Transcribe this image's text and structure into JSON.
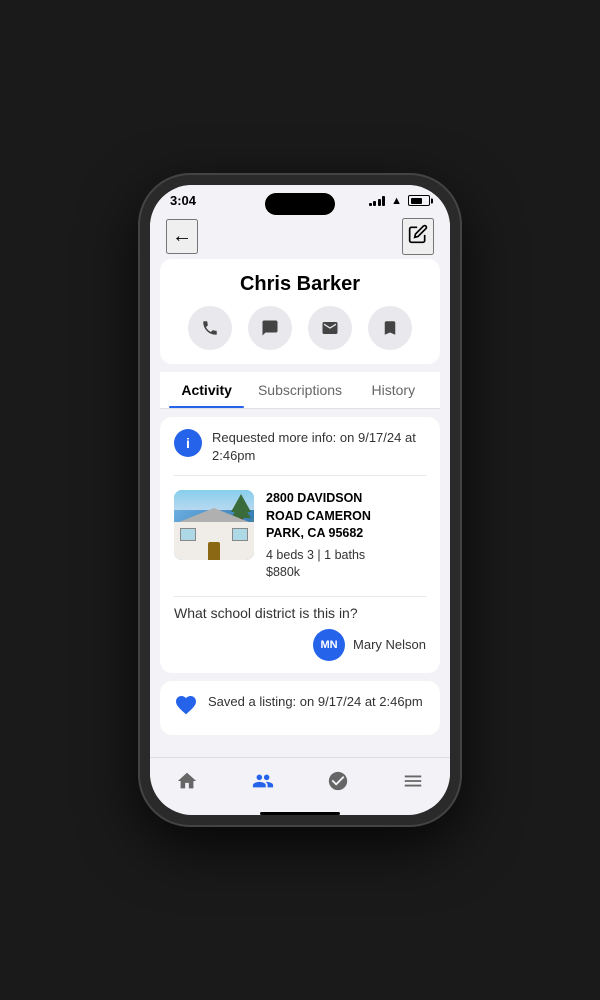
{
  "status_bar": {
    "time": "3:04",
    "signal": true,
    "wifi": true,
    "battery": true
  },
  "nav": {
    "back_label": "←",
    "edit_label": "✎"
  },
  "contact": {
    "name": "Chris Barker"
  },
  "action_buttons": [
    {
      "id": "phone",
      "icon": "📞",
      "label": "Phone"
    },
    {
      "id": "message",
      "icon": "💬",
      "label": "Message"
    },
    {
      "id": "email",
      "icon": "✉",
      "label": "Email"
    },
    {
      "id": "bookmark",
      "icon": "🔖",
      "label": "Bookmark"
    }
  ],
  "tabs": [
    {
      "id": "activity",
      "label": "Activity",
      "active": true
    },
    {
      "id": "subscriptions",
      "label": "Subscriptions",
      "active": false
    },
    {
      "id": "history",
      "label": "History",
      "active": false
    }
  ],
  "activity": {
    "info_icon": "i",
    "request_text": "Requested more info: on 9/17/24 at 2:46pm",
    "property": {
      "address_line1": "2800 DAVIDSON",
      "address_line2": "ROAD CAMERON",
      "address_line3": "PARK, CA 95682",
      "beds": "4 beds 3 | 1 baths",
      "price": "$880k"
    },
    "question": "What school district is this in?",
    "agent": {
      "initials": "MN",
      "name": "Mary Nelson"
    }
  },
  "saved_listing": {
    "heart_icon": "♥",
    "text": "Saved a listing: on 9/17/24 at 2:46pm"
  },
  "bottom_nav": [
    {
      "id": "home",
      "icon": "⌂",
      "label": "Home",
      "active": false
    },
    {
      "id": "contacts",
      "icon": "👥",
      "label": "Contacts",
      "active": true
    },
    {
      "id": "tasks",
      "icon": "✓",
      "label": "Tasks",
      "active": false
    },
    {
      "id": "menu",
      "icon": "≡",
      "label": "Menu",
      "active": false
    }
  ]
}
